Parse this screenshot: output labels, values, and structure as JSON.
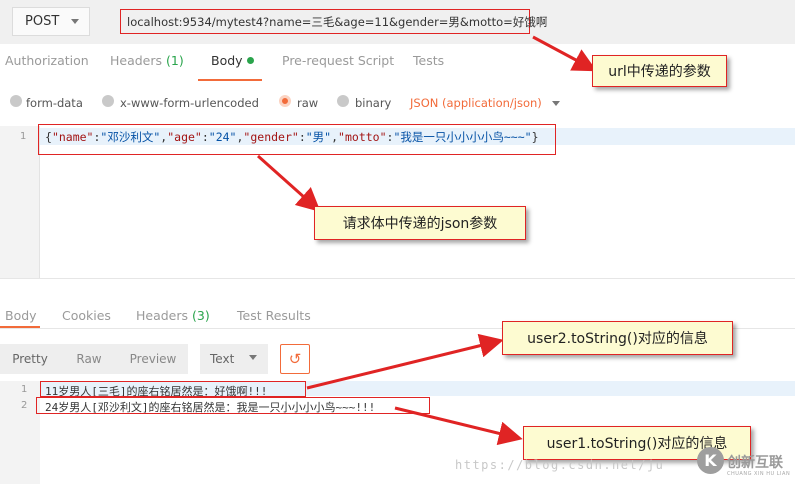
{
  "request": {
    "method": "POST",
    "url": "localhost:9534/mytest4?name=三毛&age=11&gender=男&motto=好饿啊"
  },
  "request_tabs": [
    {
      "label": "Authorization"
    },
    {
      "label": "Headers",
      "count": "(1)"
    },
    {
      "label": "Body"
    },
    {
      "label": "Pre-request Script"
    },
    {
      "label": "Tests"
    }
  ],
  "body_types": {
    "options": [
      "form-data",
      "x-www-form-urlencoded",
      "raw",
      "binary"
    ],
    "selected": "raw",
    "content_type": "JSON (application/json)"
  },
  "editor": {
    "line_number": "1",
    "open": "{",
    "close": "}",
    "pairs": [
      {
        "key": "\"name\"",
        "value": "\"邓沙利文\""
      },
      {
        "key": "\"age\"",
        "value": "\"24\""
      },
      {
        "key": "\"gender\"",
        "value": "\"男\""
      },
      {
        "key": "\"motto\"",
        "value": "\"我是一只小小小小鸟~~~\""
      }
    ]
  },
  "response_tabs": [
    {
      "label": "Body"
    },
    {
      "label": "Cookies"
    },
    {
      "label": "Headers",
      "count": "(3)"
    },
    {
      "label": "Test Results"
    }
  ],
  "response_toolbar": {
    "pretty": "Pretty",
    "raw": "Raw",
    "preview": "Preview",
    "format": "Text"
  },
  "response_lines": [
    {
      "num": "1",
      "text": "11岁男人[三毛]的座右铭居然是：好饿啊!!!"
    },
    {
      "num": "2",
      "text": "24岁男人[邓沙利文]的座右铭居然是：我是一只小小小小鸟~~~!!!"
    }
  ],
  "annotations": {
    "url_params": "url中传递的参数",
    "json_params": "请求体中传递的json参数",
    "user2": "user2.toString()对应的信息",
    "user1": "user1.toString()对应的信息"
  },
  "watermark": {
    "url": "https://blog.csdn.net/ju",
    "logo_glyph": "K",
    "brand": "创新互联",
    "brand_sub": "CHUANG XIN HU LIAN"
  },
  "colors": {
    "accent": "#f26b3a",
    "annotation_red": "#e02424",
    "annotation_fill": "#fdfbd1",
    "count_green": "#2aa44c"
  }
}
